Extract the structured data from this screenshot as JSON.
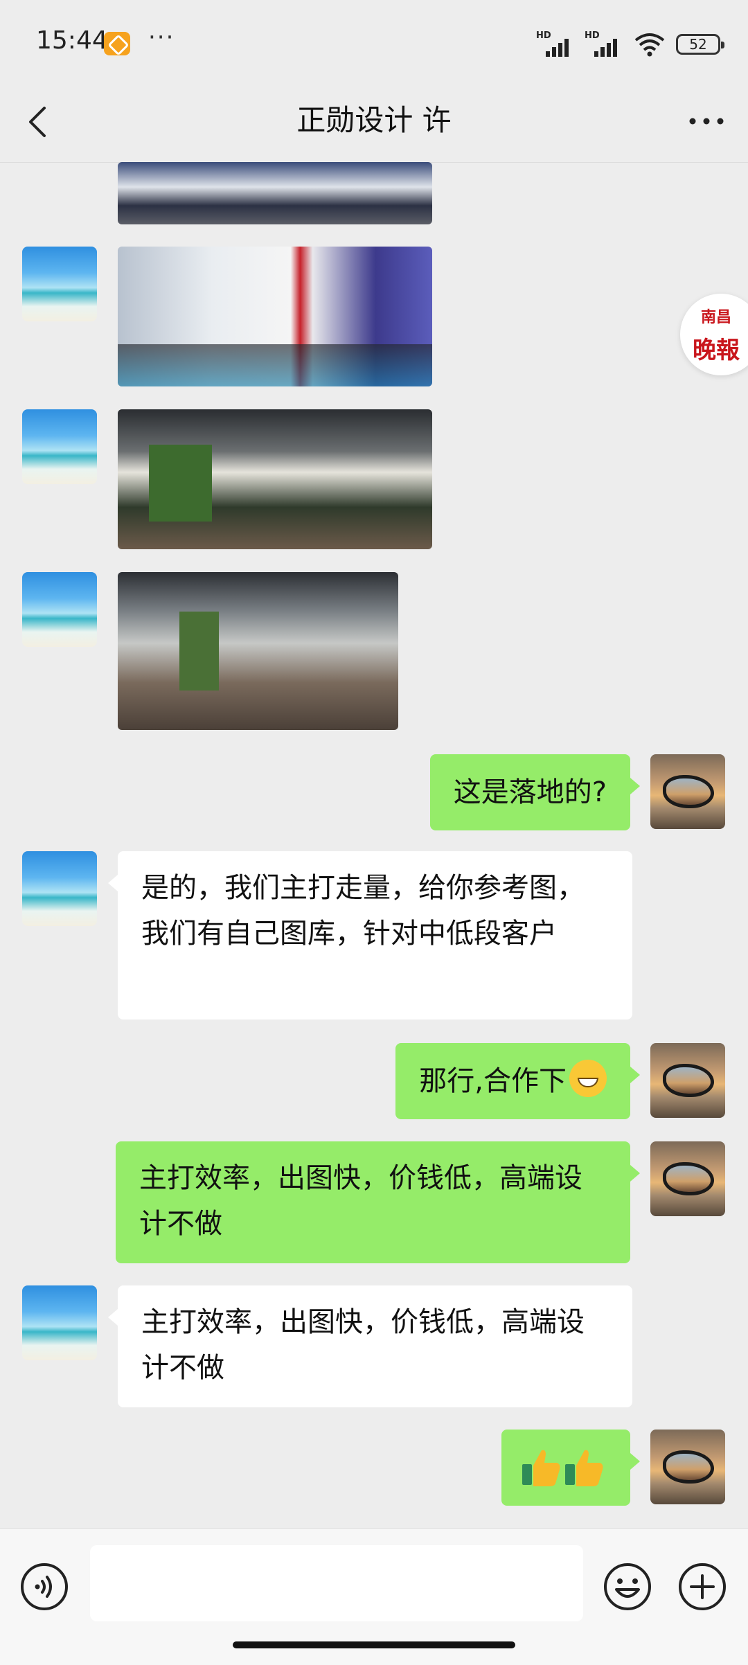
{
  "status_bar": {
    "time": "15:44",
    "more": "···",
    "battery": "52",
    "signal_labels": [
      "HD",
      "HD"
    ]
  },
  "header": {
    "title": "正勋设计 许"
  },
  "news_badge": {
    "line1": "南昌",
    "line2": "晚報"
  },
  "messages": [
    {
      "side": "in",
      "type": "image"
    },
    {
      "side": "in",
      "type": "image"
    },
    {
      "side": "in",
      "type": "image"
    },
    {
      "side": "in",
      "type": "image"
    },
    {
      "side": "out",
      "type": "text",
      "text": "这是落地的?"
    },
    {
      "side": "in",
      "type": "text",
      "text": "是的，我们主打走量，给你参考图，我们有自己图库，针对中低段客户"
    },
    {
      "side": "out",
      "type": "text",
      "text": "那行,合作下",
      "emoji": "grin-icon"
    },
    {
      "side": "out",
      "type": "text",
      "text": "主打效率，出图快，价钱低，高端设计不做"
    },
    {
      "side": "in",
      "type": "text",
      "text": "主打效率，出图快，价钱低，高端设计不做"
    },
    {
      "side": "out",
      "type": "emoji",
      "emoji": [
        "thumbs-up-icon",
        "thumbs-up-icon"
      ]
    }
  ],
  "input_bar": {
    "value": ""
  },
  "colors": {
    "outgoing_bubble": "#95ec69",
    "incoming_bubble": "#ffffff",
    "background": "#ededed"
  }
}
